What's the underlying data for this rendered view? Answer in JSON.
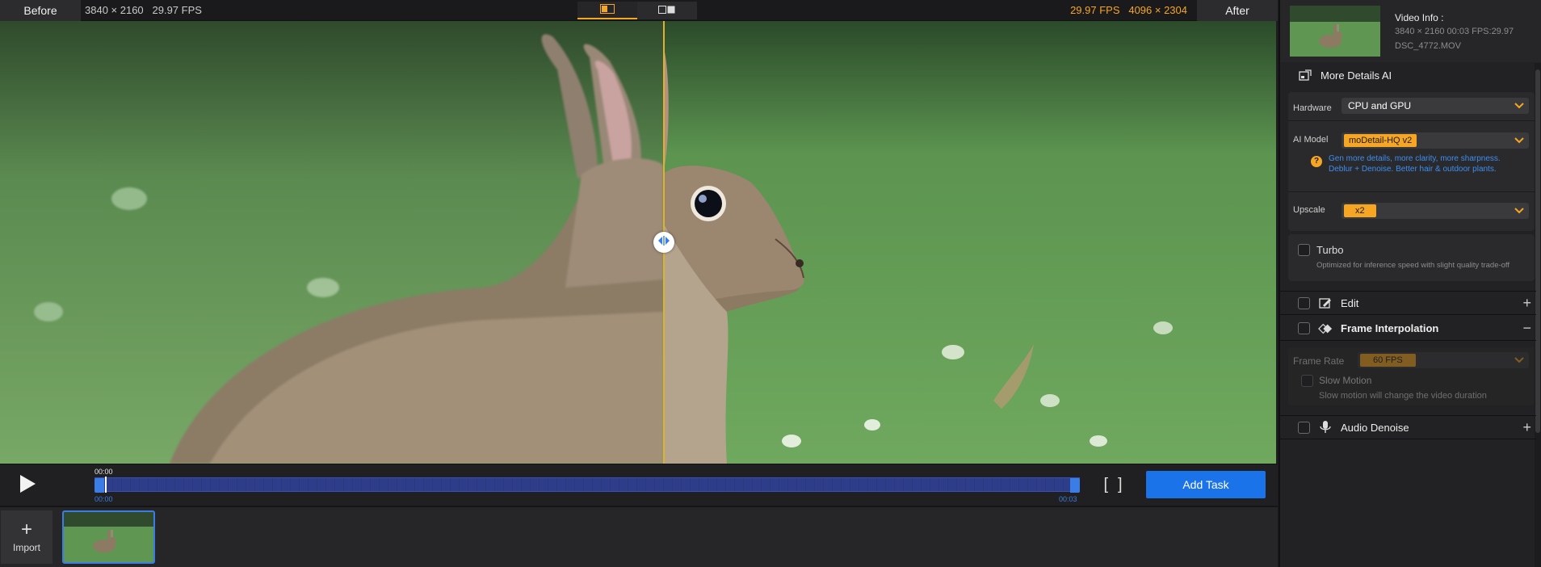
{
  "topbar": {
    "before_label": "Before",
    "before_info": "3840 × 2160   29.97 FPS",
    "after_fps": "29.97 FPS",
    "after_resolution": "4096 × 2304",
    "after_label": "After"
  },
  "timeline": {
    "current_time": "00:00",
    "start_time": "00:00",
    "end_time": "00:03",
    "add_task_label": "Add Task"
  },
  "media_bin": {
    "import_label": "Import"
  },
  "video_info": {
    "title": "Video Info :",
    "meta": "3840 × 2160 00:03 FPS:29.97",
    "filename": "DSC_4772.MOV"
  },
  "more_details": {
    "title": "More Details AI",
    "hardware_label": "Hardware",
    "hardware_value": "CPU and GPU",
    "model_label": "AI Model",
    "model_value": "moDetail-HQ  v2",
    "model_desc_line1": "Gen more details, more clarity, more sharpness.",
    "model_desc_line2": "Deblur + Denoise. Better hair & outdoor plants.",
    "upscale_label": "Upscale",
    "upscale_value": "x2",
    "turbo_label": "Turbo",
    "turbo_desc": "Optimized for inference speed with slight quality trade-off"
  },
  "edit": {
    "title": "Edit"
  },
  "frame_interpolation": {
    "title": "Frame Interpolation",
    "frame_rate_label": "Frame Rate",
    "frame_rate_value": "60 FPS",
    "slow_motion_label": "Slow Motion",
    "slow_motion_desc": "Slow motion will change the video duration"
  },
  "audio_denoise": {
    "title": "Audio Denoise"
  },
  "colors": {
    "accent_orange": "#f6a623",
    "accent_blue": "#1a73e8"
  }
}
